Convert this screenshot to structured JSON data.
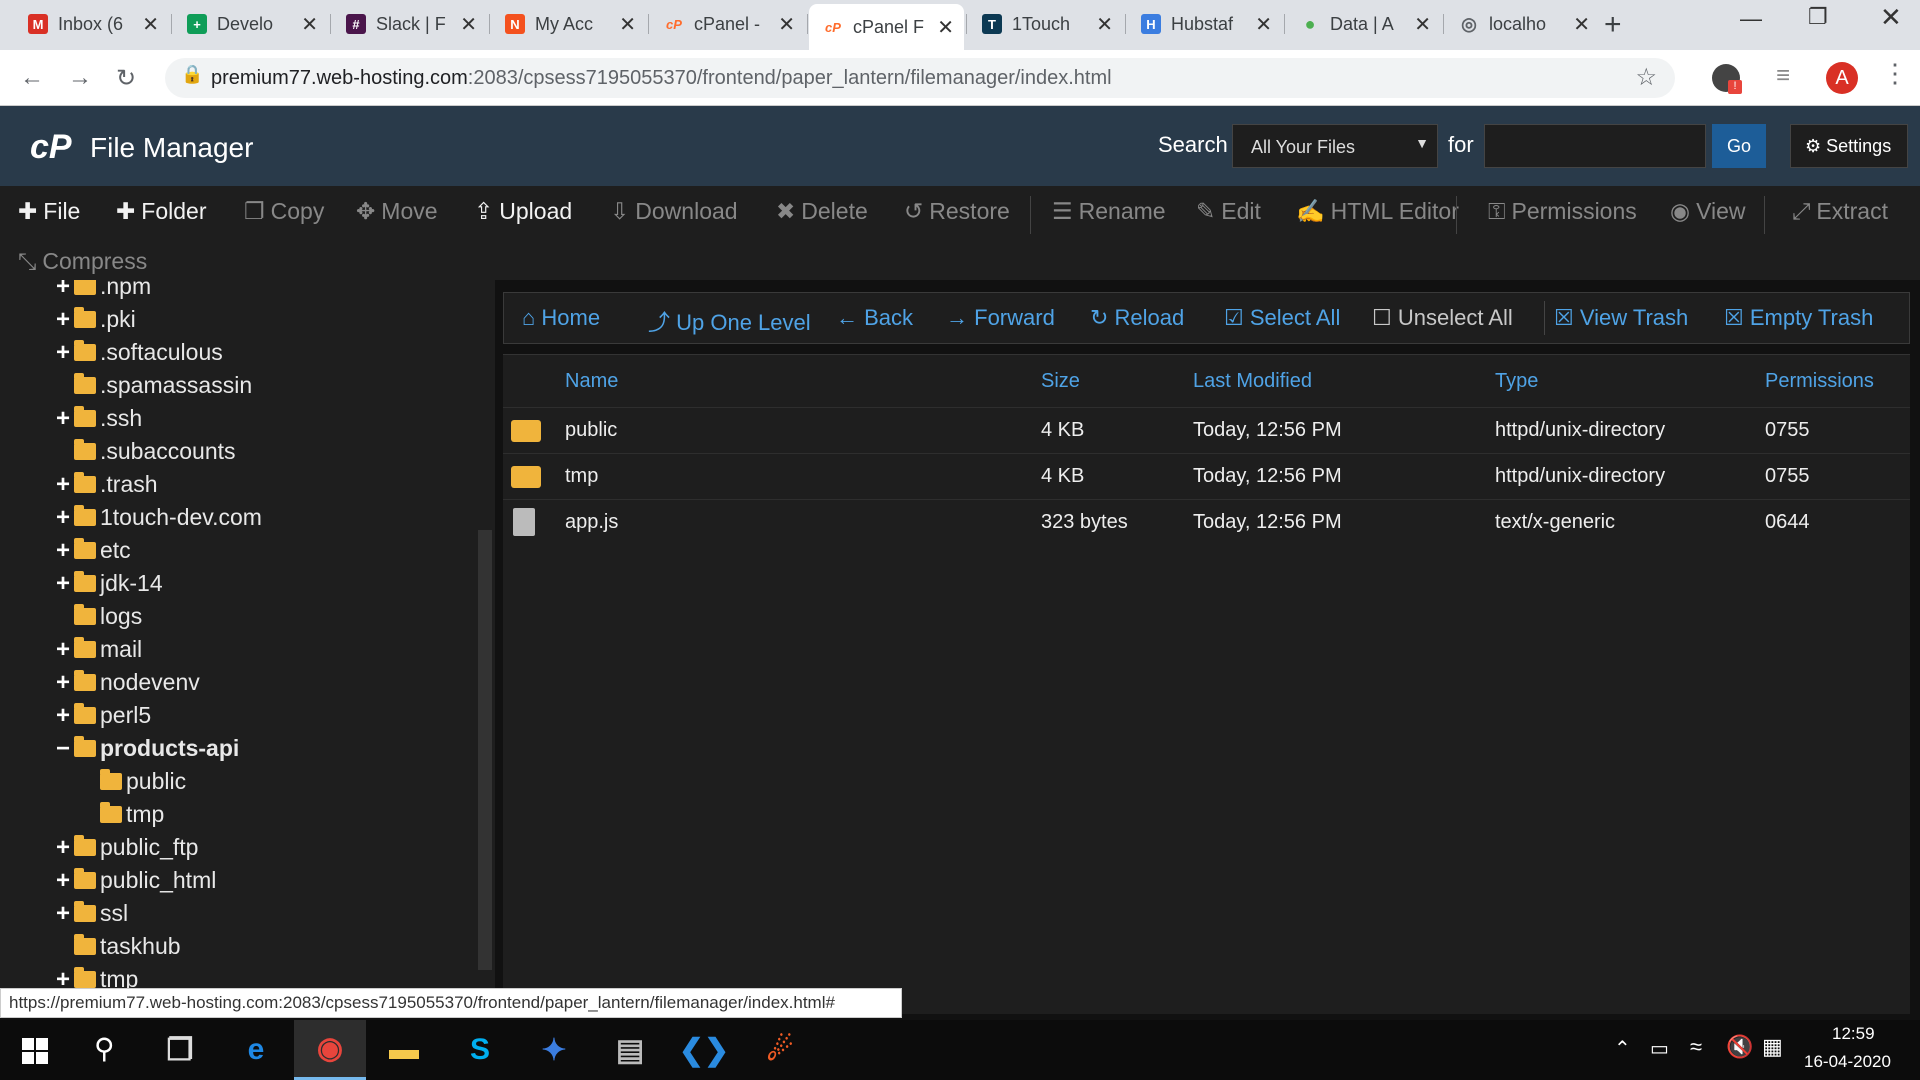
{
  "browser": {
    "tabs": [
      {
        "title": "Inbox (6",
        "icon": "gmail-icon",
        "color": "#d93025",
        "glyph": "M"
      },
      {
        "title": "Develo",
        "icon": "sheets-icon",
        "color": "#0f9d58",
        "glyph": "+"
      },
      {
        "title": "Slack | F",
        "icon": "slack-icon",
        "color": "#4a154b",
        "glyph": "#"
      },
      {
        "title": "My Acc",
        "icon": "namecheap-icon",
        "color": "#f4511e",
        "glyph": "N"
      },
      {
        "title": "cPanel -",
        "icon": "cpanel-icon",
        "color": "#ff6c2c",
        "glyph": "cP"
      },
      {
        "title": "cPanel F",
        "icon": "cpanel-icon",
        "color": "#ff6c2c",
        "glyph": "cP"
      },
      {
        "title": "1Touch",
        "icon": "trello-icon",
        "color": "#0c3953",
        "glyph": "T"
      },
      {
        "title": "Hubstaf",
        "icon": "hubstaff-icon",
        "color": "#3b7de0",
        "glyph": "H"
      },
      {
        "title": "Data | A",
        "icon": "mongodb-icon",
        "color": "#4caf50",
        "glyph": "●"
      },
      {
        "title": "localho",
        "icon": "globe-icon",
        "color": "#5f6368",
        "glyph": "◎"
      }
    ],
    "url_host": "premium77.web-hosting.com",
    "url_path": ":2083/cpsess7195055370/frontend/paper_lantern/filemanager/index.html",
    "profile_initial": "A",
    "profile_color": "#d93025"
  },
  "cpanel": {
    "app_title": "File Manager",
    "search_label": "Search",
    "search_scope": "All Your Files",
    "for_label": "for",
    "search_value": "",
    "go_label": "Go",
    "settings_label": "Settings",
    "header_bg": "#293a4a",
    "accent": "#4fa3e6"
  },
  "toolbar": [
    {
      "label": "File",
      "icon": "plus-icon",
      "glyph": "✚",
      "enabled": true
    },
    {
      "label": "Folder",
      "icon": "plus-icon",
      "glyph": "✚",
      "enabled": true
    },
    {
      "label": "Copy",
      "icon": "copy-icon",
      "glyph": "❐",
      "enabled": false
    },
    {
      "label": "Move",
      "icon": "move-icon",
      "glyph": "✥",
      "enabled": false
    },
    {
      "label": "Upload",
      "icon": "upload-icon",
      "glyph": "⇪",
      "enabled": true
    },
    {
      "label": "Download",
      "icon": "download-icon",
      "glyph": "⇩",
      "enabled": false
    },
    {
      "label": "Delete",
      "icon": "delete-icon",
      "glyph": "✖",
      "enabled": false
    },
    {
      "label": "Restore",
      "icon": "restore-icon",
      "glyph": "↺",
      "enabled": false
    },
    {
      "label": "Rename",
      "icon": "rename-icon",
      "glyph": "☰",
      "enabled": false
    },
    {
      "label": "Edit",
      "icon": "edit-icon",
      "glyph": "✎",
      "enabled": false
    },
    {
      "label": "HTML Editor",
      "icon": "html-editor-icon",
      "glyph": "✍",
      "enabled": false
    },
    {
      "label": "Permissions",
      "icon": "key-icon",
      "glyph": "⚿",
      "enabled": false
    },
    {
      "label": "View",
      "icon": "eye-icon",
      "glyph": "◉",
      "enabled": false
    },
    {
      "label": "Extract",
      "icon": "extract-icon",
      "glyph": "⤢",
      "enabled": false
    },
    {
      "label": "Compress",
      "icon": "compress-icon",
      "glyph": "⤡",
      "enabled": false
    }
  ],
  "tree": [
    {
      "name": ".npm",
      "toggle": "+",
      "bold": false
    },
    {
      "name": ".pki",
      "toggle": "+",
      "bold": false
    },
    {
      "name": ".softaculous",
      "toggle": "+",
      "bold": false
    },
    {
      "name": ".spamassassin",
      "toggle": "",
      "bold": false
    },
    {
      "name": ".ssh",
      "toggle": "+",
      "bold": false
    },
    {
      "name": ".subaccounts",
      "toggle": "",
      "bold": false
    },
    {
      "name": ".trash",
      "toggle": "+",
      "bold": false
    },
    {
      "name": "1touch-dev.com",
      "toggle": "+",
      "bold": false
    },
    {
      "name": "etc",
      "toggle": "+",
      "bold": false
    },
    {
      "name": "jdk-14",
      "toggle": "+",
      "bold": false
    },
    {
      "name": "logs",
      "toggle": "",
      "bold": false
    },
    {
      "name": "mail",
      "toggle": "+",
      "bold": false
    },
    {
      "name": "nodevenv",
      "toggle": "+",
      "bold": false
    },
    {
      "name": "perl5",
      "toggle": "+",
      "bold": false
    },
    {
      "name": "products-api",
      "toggle": "−",
      "bold": true
    },
    {
      "name": "public",
      "toggle": "",
      "bold": false,
      "child": true
    },
    {
      "name": "tmp",
      "toggle": "",
      "bold": false,
      "child": true
    },
    {
      "name": "public_ftp",
      "toggle": "+",
      "bold": false
    },
    {
      "name": "public_html",
      "toggle": "+",
      "bold": false
    },
    {
      "name": "ssl",
      "toggle": "+",
      "bold": false
    },
    {
      "name": "taskhub",
      "toggle": "",
      "bold": false
    },
    {
      "name": "tmp",
      "toggle": "+",
      "bold": false
    }
  ],
  "navbar": [
    {
      "label": "Home",
      "icon": "home-icon",
      "glyph": "⌂"
    },
    {
      "label": "Up One Level",
      "icon": "level-up-icon",
      "glyph": "⤴"
    },
    {
      "label": "Back",
      "icon": "arrow-left-icon",
      "glyph": "←"
    },
    {
      "label": "Forward",
      "icon": "arrow-right-icon",
      "glyph": "→"
    },
    {
      "label": "Reload",
      "icon": "reload-icon",
      "glyph": "↻"
    },
    {
      "label": "Select All",
      "icon": "checkbox-checked-icon",
      "glyph": "☑"
    },
    {
      "label": "Unselect All",
      "icon": "checkbox-empty-icon",
      "glyph": "☐"
    },
    {
      "label": "View Trash",
      "icon": "trash-icon",
      "glyph": "☒"
    },
    {
      "label": "Empty Trash",
      "icon": "trash-icon",
      "glyph": "☒"
    }
  ],
  "files": {
    "columns": [
      "Name",
      "Size",
      "Last Modified",
      "Type",
      "Permissions"
    ],
    "rows": [
      {
        "name": "public",
        "size": "4 KB",
        "modified": "Today, 12:56 PM",
        "type": "httpd/unix-directory",
        "perms": "0755",
        "kind": "folder"
      },
      {
        "name": "tmp",
        "size": "4 KB",
        "modified": "Today, 12:56 PM",
        "type": "httpd/unix-directory",
        "perms": "0755",
        "kind": "folder"
      },
      {
        "name": "app.js",
        "size": "323 bytes",
        "modified": "Today, 12:56 PM",
        "type": "text/x-generic",
        "perms": "0644",
        "kind": "file"
      }
    ]
  },
  "status_url": "https://premium77.web-hosting.com:2083/cpsess7195055370/frontend/paper_lantern/filemanager/index.html#",
  "taskbar": {
    "apps": [
      {
        "icon": "task-view-icon",
        "glyph": "❐",
        "color": "#ddd"
      },
      {
        "icon": "edge-icon",
        "glyph": "e",
        "color": "#1e88e5"
      },
      {
        "icon": "chrome-icon",
        "glyph": "◉",
        "color": "#e8453c"
      },
      {
        "icon": "file-explorer-icon",
        "glyph": "▬",
        "color": "#f6c94c"
      },
      {
        "icon": "skype-icon",
        "glyph": "S",
        "color": "#00aff0"
      },
      {
        "icon": "hubstaff-icon",
        "glyph": "✦",
        "color": "#3b7de0"
      },
      {
        "icon": "terminal-icon",
        "glyph": "▤",
        "color": "#bbb"
      },
      {
        "icon": "vscode-icon",
        "glyph": "❮❯",
        "color": "#2a8be0"
      },
      {
        "icon": "postman-icon",
        "glyph": "☄",
        "color": "#ef5b25"
      }
    ],
    "time": "12:59",
    "date": "16-04-2020"
  }
}
